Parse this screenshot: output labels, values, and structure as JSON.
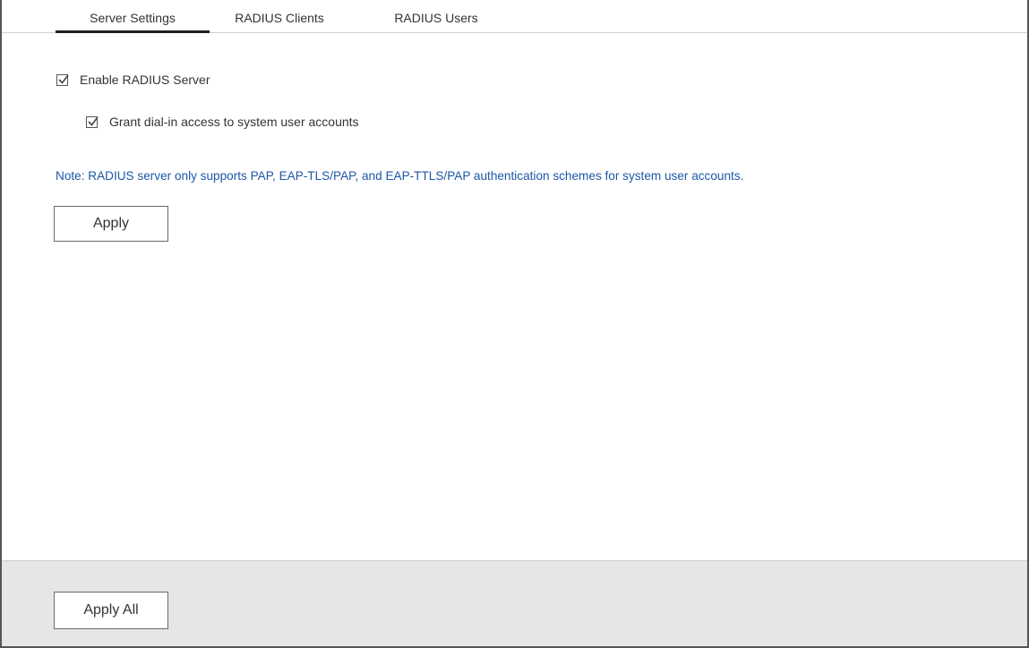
{
  "tabs": [
    {
      "label": "Server Settings",
      "active": true
    },
    {
      "label": "RADIUS Clients",
      "active": false
    },
    {
      "label": "RADIUS Users",
      "active": false
    }
  ],
  "settings": {
    "enable_radius": {
      "label": "Enable RADIUS Server",
      "checked": true
    },
    "grant_dialin": {
      "label": "Grant dial-in access to system user accounts",
      "checked": true
    },
    "note": "Note: RADIUS server only supports PAP, EAP-TLS/PAP, and EAP-TTLS/PAP authentication schemes for system user accounts.",
    "apply_label": "Apply"
  },
  "footer": {
    "apply_all_label": "Apply All"
  },
  "colors": {
    "note_text": "#1d57a6",
    "footer_bg": "#e6e6e6",
    "active_tab_underline": "#1f1f1f"
  },
  "icons": {
    "checkbox": "checkmark-icon"
  }
}
